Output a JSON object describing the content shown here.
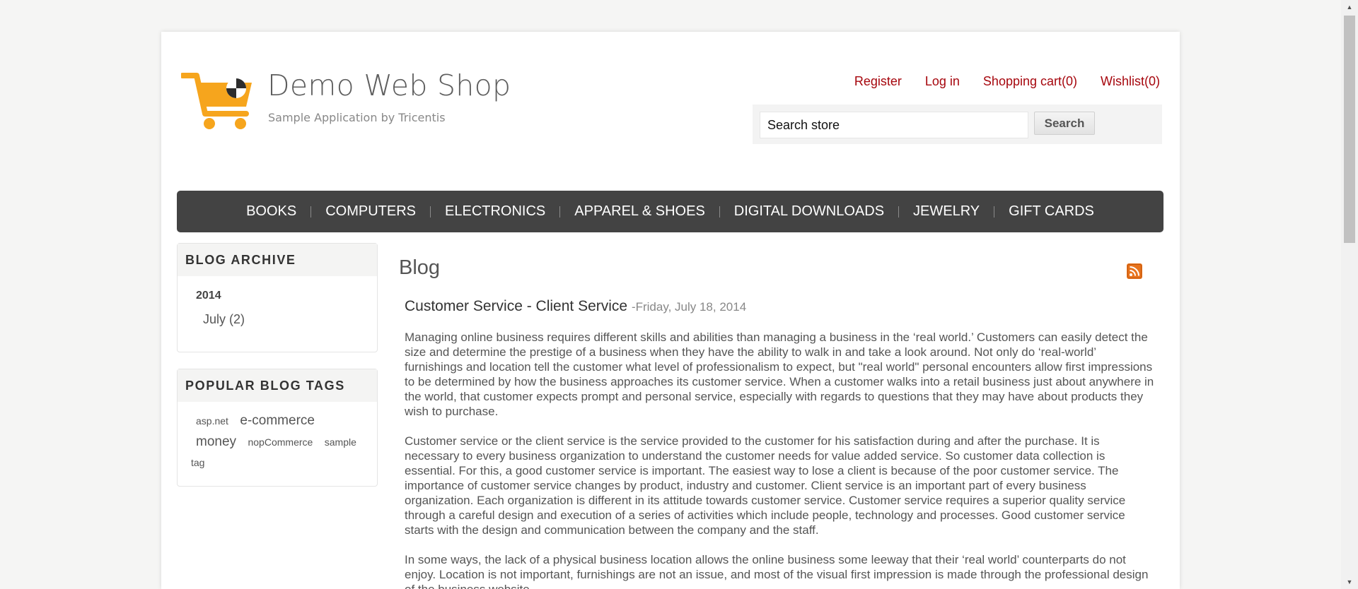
{
  "colors": {
    "link": "#a6060d",
    "menu_bg": "#434343",
    "logo_orange": "#f6a51d"
  },
  "header": {
    "logo_title": "Demo Web Shop",
    "logo_subtitle": "Sample Application by Tricentis",
    "links": [
      "Register",
      "Log in",
      "Shopping cart(0)",
      "Wishlist(0)"
    ],
    "search": {
      "value": "Search store",
      "button": "Search"
    }
  },
  "menu": [
    "BOOKS",
    "COMPUTERS",
    "ELECTRONICS",
    "APPAREL & SHOES",
    "DIGITAL DOWNLOADS",
    "JEWELRY",
    "GIFT CARDS"
  ],
  "sidebar": {
    "archive": {
      "title": "BLOG ARCHIVE",
      "year": "2014",
      "month": "July (2)"
    },
    "tags": {
      "title": "POPULAR BLOG TAGS",
      "items": [
        "asp.net",
        "e-commerce",
        "money",
        "nopCommerce",
        "sample",
        "tag"
      ]
    }
  },
  "main": {
    "title": "Blog",
    "rss_icon": "rss-icon",
    "post": {
      "title": "Customer Service - Client Service",
      "date": "-Friday, July 18, 2014",
      "paragraphs": [
        "Managing online business requires different skills and abilities than managing a business in the ‘real world.’ Customers can easily detect the size and determine the prestige of a business when they have the ability to walk in and take a look around. Not only do ‘real-world’ furnishings and location tell the customer what level of professionalism to expect, but \"real world\" personal encounters allow first impressions to be determined by how the business approaches its customer service. When a customer walks into a retail business just about anywhere in the world, that customer expects prompt and personal service, especially with regards to questions that they may have about products they wish to purchase.",
        "Customer service or the client service is the service provided to the customer for his satisfaction during and after the purchase. It is necessary to every business organization to understand the customer needs for value added service. So customer data collection is essential. For this, a good customer service is important. The easiest way to lose a client is because of the poor customer service. The importance of customer service changes by product, industry and customer. Client service is an important part of every business organization. Each organization is different in its attitude towards customer service. Customer service requires a superior quality service through a careful design and execution of a series of activities which include people, technology and processes. Good customer service starts with the design and communication between the company and the staff.",
        "In some ways, the lack of a physical business location allows the online business some leeway that their ‘real world’ counterparts do not enjoy. Location is not important, furnishings are not an issue, and most of the visual first impression is made through the professional design of the business website."
      ]
    }
  }
}
